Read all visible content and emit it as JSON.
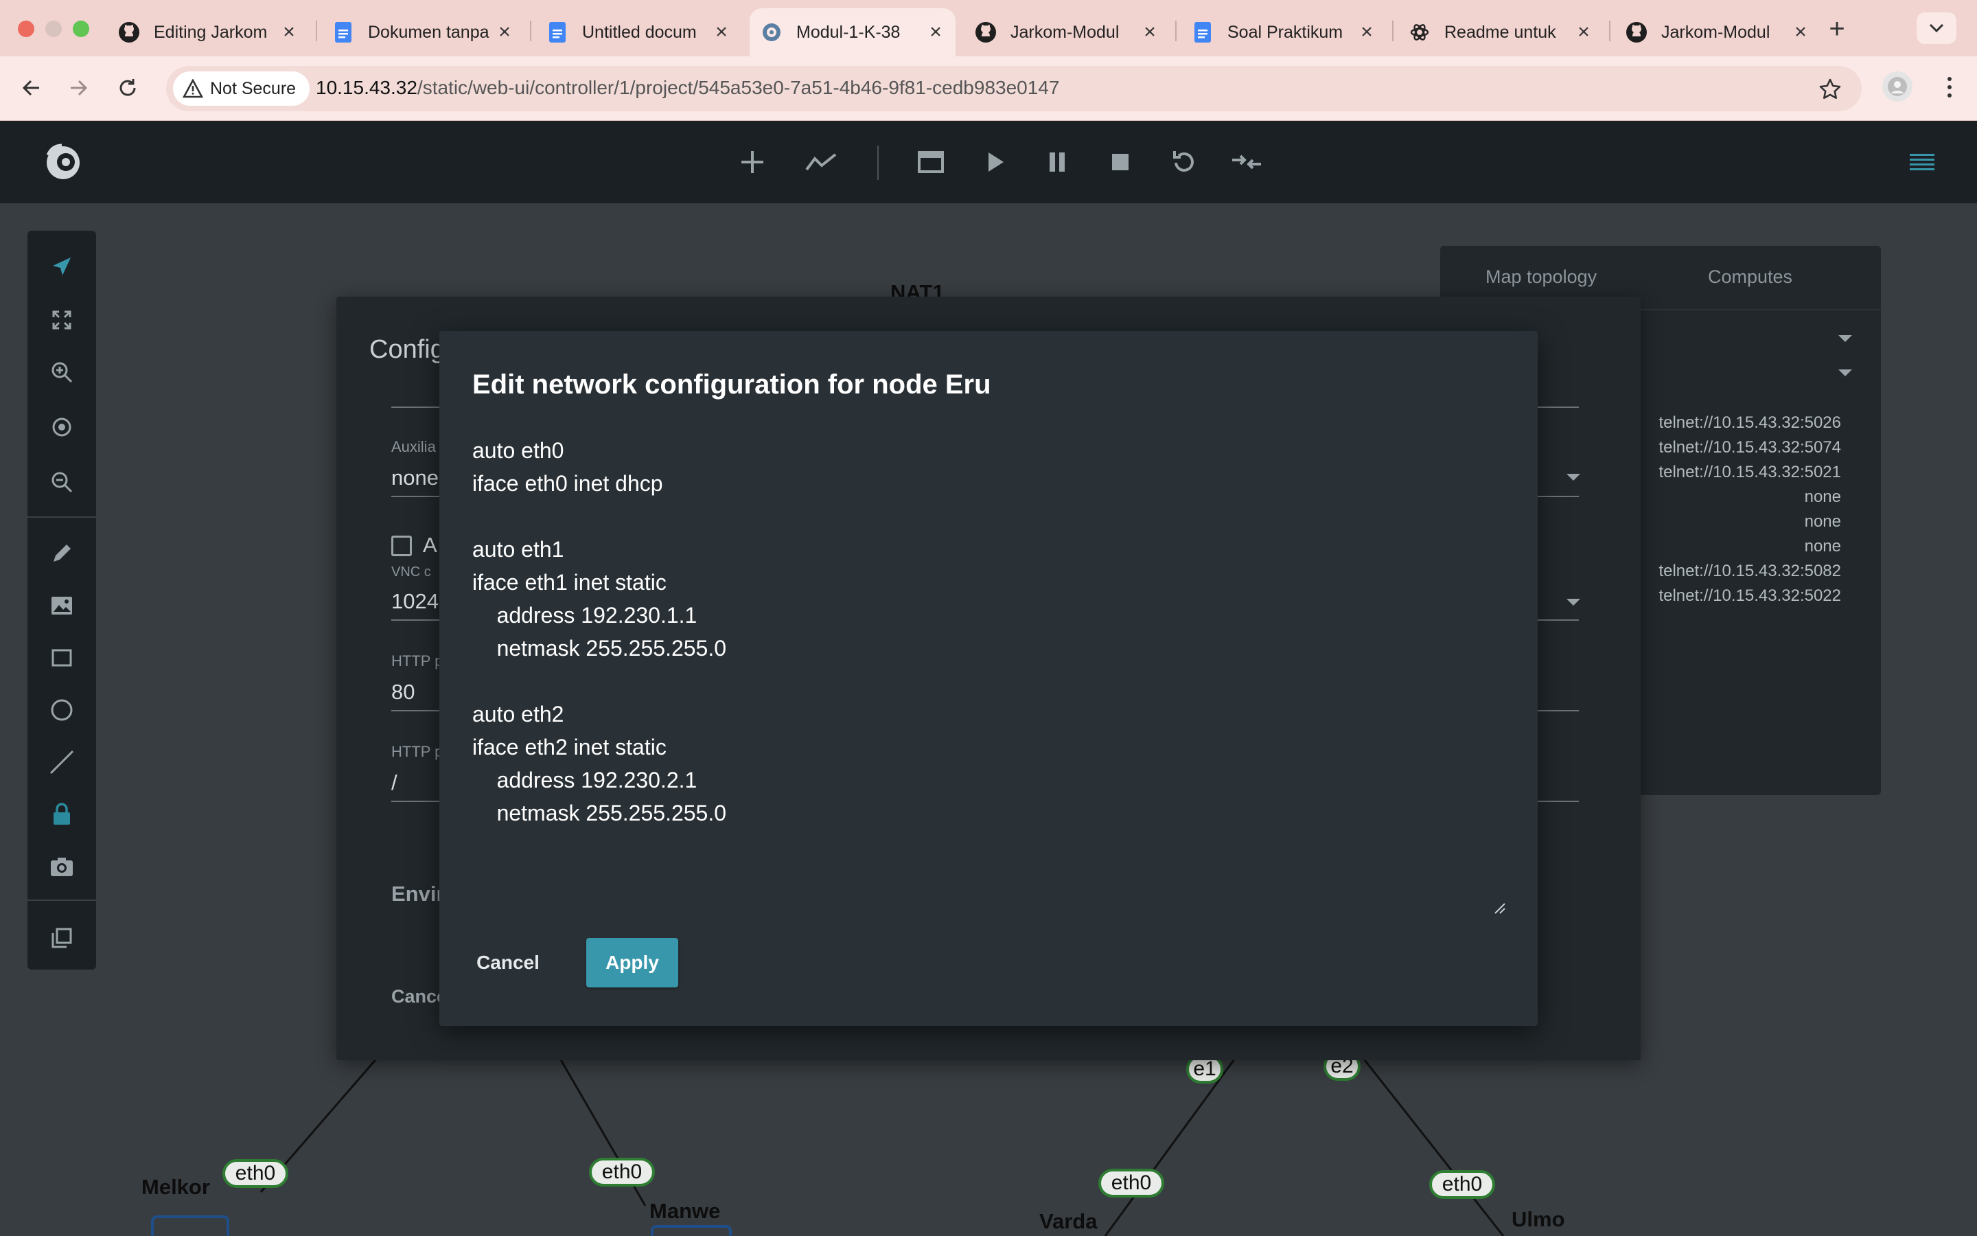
{
  "browser": {
    "tabs": [
      {
        "title": "Editing Jarkom",
        "icon": "github-icon",
        "active": false
      },
      {
        "title": "Dokumen tanpa",
        "icon": "google-docs-icon",
        "active": false
      },
      {
        "title": "Untitled docum",
        "icon": "google-docs-icon",
        "active": false
      },
      {
        "title": "Modul-1-K-38",
        "icon": "gns3-icon",
        "active": true
      },
      {
        "title": "Jarkom-Modul",
        "icon": "github-icon",
        "active": false
      },
      {
        "title": "Soal Praktikum",
        "icon": "google-docs-icon",
        "active": false
      },
      {
        "title": "Readme untuk",
        "icon": "chatgpt-icon",
        "active": false
      },
      {
        "title": "Jarkom-Modul",
        "icon": "github-icon",
        "active": false
      }
    ],
    "security_label": "Not Secure",
    "url_host": "10.15.43.32",
    "url_path": "/static/web-ui/controller/1/project/545a53e0-7a51-4b46-9f81-cedb983e0147",
    "colors": {
      "tabstrip": "#f1d3cf",
      "toolbar": "#fbe9e7"
    }
  },
  "app": {
    "logo": "gns3-chameleon-logo",
    "toolbar_icons": [
      "add-node-icon",
      "show-interface-labels-icon",
      "console-icon",
      "start-icon",
      "suspend-icon",
      "stop-icon",
      "reload-icon",
      "reset-icon"
    ],
    "menu_icon": "hamburger-icon",
    "accent": "#3997ac",
    "left_tools": [
      "select-icon",
      "fit-icon",
      "zoom-in-icon",
      "reset-zoom-icon",
      "zoom-out-icon",
      "draw-icon",
      "image-icon",
      "rectangle-icon",
      "ellipse-icon",
      "line-icon",
      "lock-icon",
      "screenshot-icon",
      "layers-icon"
    ]
  },
  "topology_panel": {
    "tabs": [
      "Map topology",
      "Computes"
    ],
    "lines": [
      "telnet://10.15.43.32:5026",
      "telnet://10.15.43.32:5074",
      "telnet://10.15.43.32:5021",
      "none",
      "none",
      "none",
      "telnet://10.15.43.32:5082",
      "telnet://10.15.43.32:5022"
    ]
  },
  "config_dialog": {
    "title": "Config",
    "aux_label": "Auxilia",
    "aux_value": "none",
    "checkbox_label": "A",
    "vnc_label": "VNC c",
    "vnc_value": "1024",
    "http_port_label": "HTTP p",
    "http_port_value": "80",
    "http_path_label": "HTTP p",
    "http_path_value": "/",
    "env_label": "Envir",
    "cancel_label": "Cance"
  },
  "edit_dialog": {
    "title": "Edit network configuration for node Eru",
    "config_text": "auto eth0\niface eth0 inet dhcp\n\nauto eth1\niface eth1 inet static\n\taddress 192.230.1.1\n\tnetmask 255.255.255.0\n\nauto eth2\niface eth2 inet static\n\taddress 192.230.2.1\n\tnetmask 255.255.255.0",
    "cancel_label": "Cancel",
    "apply_label": "Apply"
  },
  "map": {
    "nodes": [
      "NAT1",
      "Melkor",
      "Manwe",
      "Varda",
      "Ulmo"
    ],
    "interfaces": [
      "e1",
      "e2",
      "eth0",
      "eth0",
      "eth0",
      "eth0"
    ]
  }
}
